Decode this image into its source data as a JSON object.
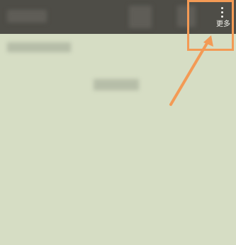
{
  "toolbar": {
    "more_label": "更多",
    "more_icon": "more-vert-icon"
  },
  "annotation": {
    "highlight_color": "#f39a55",
    "arrow_color": "#f39a55"
  },
  "colors": {
    "toolbar_bg": "#4e4d47",
    "page_bg": "#d6ddc4"
  }
}
